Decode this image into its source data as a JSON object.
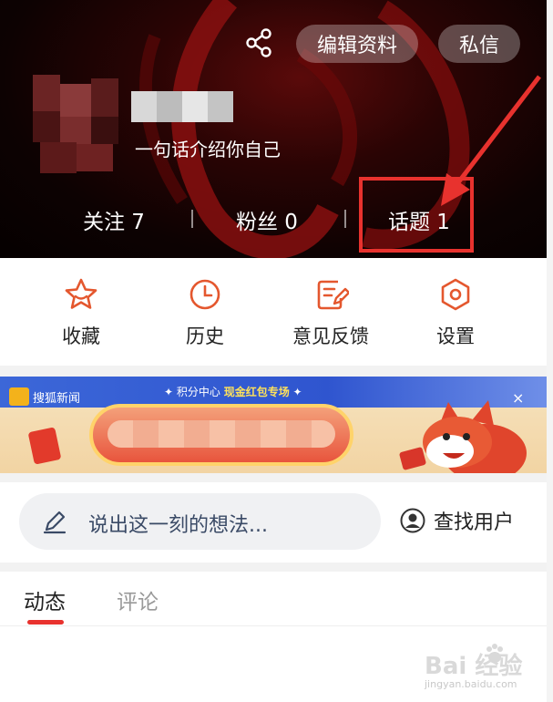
{
  "header": {
    "share_icon": "share-icon",
    "edit_profile_label": "编辑资料",
    "message_label": "私信",
    "bio": "一句话介绍你自己",
    "stats": {
      "follow": "关注 7",
      "fans": "粉丝 0",
      "topic": "话题 1"
    },
    "annotation_color": "#e8322e"
  },
  "actions": [
    {
      "label": "收藏",
      "icon": "star-icon"
    },
    {
      "label": "历史",
      "icon": "clock-icon"
    },
    {
      "label": "意见反馈",
      "icon": "feedback-edit-icon"
    },
    {
      "label": "设置",
      "icon": "settings-hexagon-icon"
    }
  ],
  "banner": {
    "brand": "搜狐新闻",
    "title_prefix": "积分中心",
    "title_highlight": "现金红包专场",
    "close": "×"
  },
  "composer": {
    "placeholder": "说出这一刻的想法...",
    "find_user": "查找用户"
  },
  "tabs": {
    "active": "动态",
    "inactive": "评论"
  },
  "watermark": {
    "main": "Bai  经验",
    "sub": "jingyan.baidu.com"
  },
  "colors": {
    "accent": "#e8322e",
    "icon_orange": "#e4572e"
  }
}
